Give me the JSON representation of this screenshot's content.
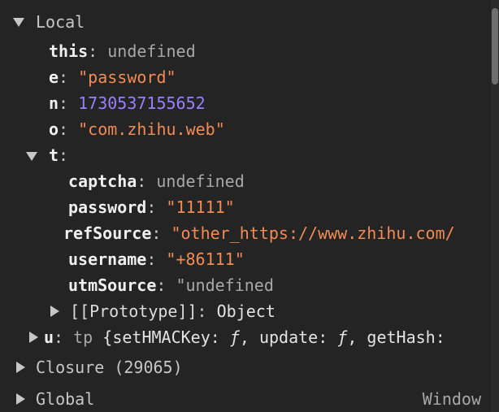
{
  "local": {
    "title": "Local",
    "vars": [
      {
        "key": "this",
        "value": "undefined"
      },
      {
        "key": "e",
        "value": "\"password\""
      },
      {
        "key": "n",
        "value": "1730537155652"
      },
      {
        "key": "o",
        "value": "\"com.zhihu.web\""
      }
    ],
    "t": {
      "key": "t",
      "props": [
        {
          "key": "captcha",
          "value": "undefined"
        },
        {
          "key": "password",
          "value": "\"11111\""
        },
        {
          "key": "refSource",
          "value": "\"other_https://www.zhihu.com/"
        },
        {
          "key": "username",
          "value": "\"+86111\""
        },
        {
          "key": "utmSource",
          "value": "\"undefined"
        }
      ],
      "prototype_label": "[[Prototype]]",
      "prototype_value": "Object"
    },
    "u": {
      "key": "u",
      "type": "tp",
      "preview_open": "{setHMACKey:",
      "f1": "ƒ",
      "preview_mid": ", update:",
      "f2": "ƒ",
      "preview_end": ", getHash:"
    }
  },
  "closure": {
    "title": "Closure (29065)"
  },
  "global": {
    "title": "Global",
    "right": "Window"
  },
  "colors": {
    "string": "#f28b54",
    "number": "#9980ff",
    "undefined": "#a8a8a8"
  }
}
